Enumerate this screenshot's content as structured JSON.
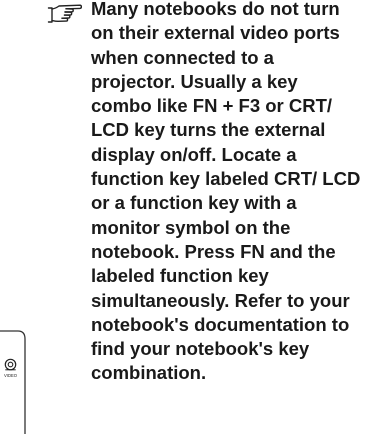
{
  "note": {
    "icon": "pointing-hand-icon",
    "text": "Many notebooks do not turn on their external video ports when connected to a projector. Usually a key combo like FN + F3 or CRT/ LCD key turns the external display on/off. Locate a function key labeled CRT/ LCD or a function key with a monitor symbol on the notebook. Press FN and the labeled function key simultaneously. Refer to your notebook's documentation to find your notebook's key combination."
  },
  "illustration": {
    "icon": "video-port-icon",
    "label": "VIDEO"
  }
}
